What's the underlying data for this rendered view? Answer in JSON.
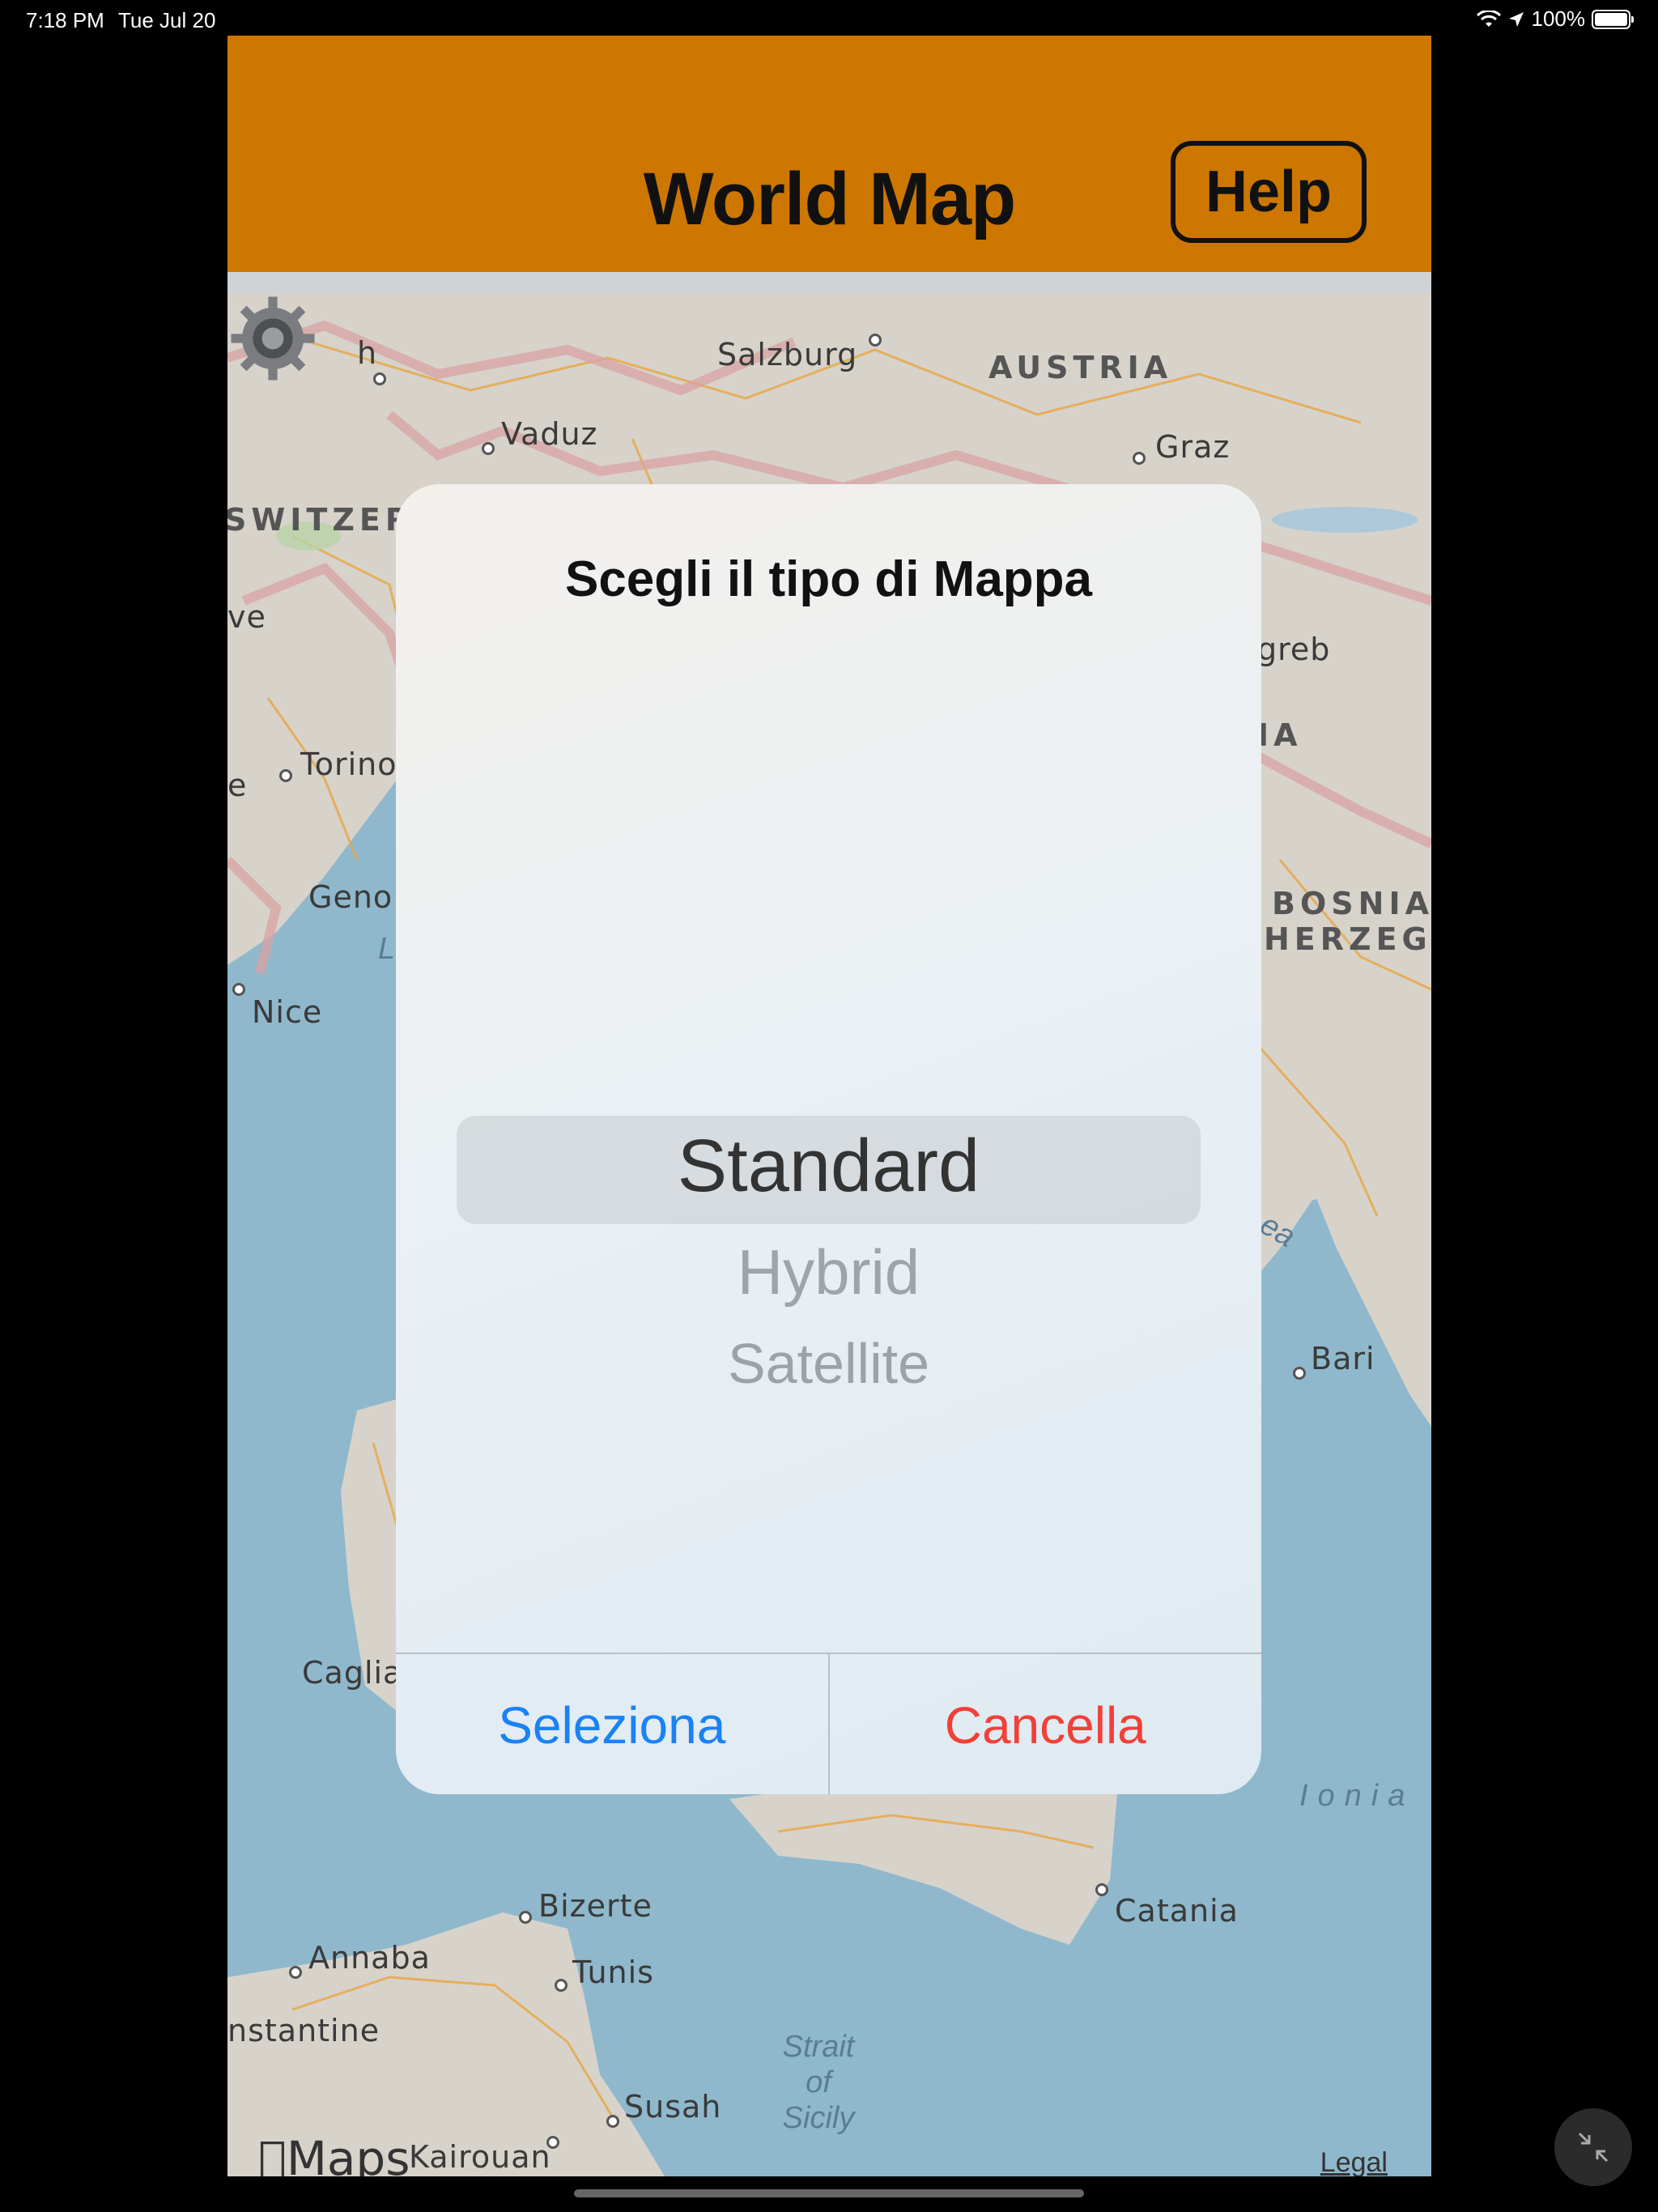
{
  "status_bar": {
    "time": "7:18 PM",
    "date": "Tue Jul 20",
    "battery": "100%",
    "battery_level": 1.0
  },
  "header": {
    "title": "World Map",
    "help_label": "Help"
  },
  "map": {
    "labels": {
      "salzburg": "Salzburg",
      "austria": "AUSTRIA",
      "vaduz": "Vaduz",
      "graz": "Graz",
      "switzerland": "SWITZERLAND",
      "zagreb_fragment": "greb",
      "croatia_fragment": "IA",
      "torino": "Torino",
      "genova": "Geno",
      "nice": "Nice",
      "bosnia": "BOSNIA",
      "herzego": "HERZEGO",
      "bari": "Bari",
      "cagliari": "Caglia",
      "ionian": "Ionia",
      "bizerte": "Bizerte",
      "annaba": "Annaba",
      "tunis": "Tunis",
      "catania": "Catania",
      "constantine": "nstantine",
      "susah": "Susah",
      "kairouan": "Kairouan",
      "strait": "Strait\nof\nSicily",
      "adriatic_fragment": "ea",
      "ve_fragment": "ve",
      "ch_fragment": "h",
      "e_fragment": "e",
      "l_fragment": "L"
    },
    "maps_logo": "Maps",
    "legal": "Legal"
  },
  "dialog": {
    "title": "Scegli il tipo di Mappa",
    "options": [
      "Standard",
      "Hybrid",
      "Satellite"
    ],
    "selected": "Standard",
    "confirm_label": "Seleziona",
    "cancel_label": "Cancella"
  },
  "icons": {
    "settings": "gear-icon",
    "collapse": "collapse-arrows-icon",
    "wifi": "wifi-icon",
    "location": "location-arrow-icon",
    "apple": "apple-logo-icon"
  },
  "colors": {
    "header": "#cd7700",
    "confirm": "#1a82f5",
    "cancel": "#f24038",
    "sea": "#8fb8cc",
    "land": "#d7d3cb"
  }
}
